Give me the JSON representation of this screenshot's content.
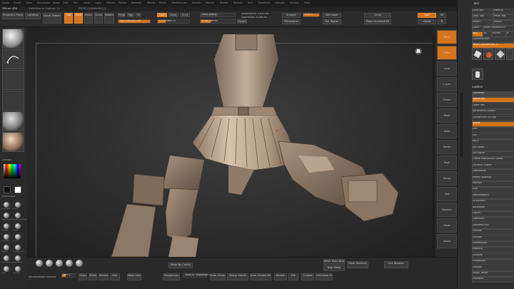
{
  "menu": [
    "Alpha",
    "Brush",
    "Color",
    "Document",
    "Draw",
    "Edit",
    "File",
    "Layer",
    "Light",
    "Macro",
    "Marker",
    "Material",
    "Movie",
    "Picker",
    "Preferences",
    "Render",
    "Stencil",
    "Stroke",
    "Texture",
    "Tool",
    "Transform",
    "Zplugin",
    "Zscript",
    "Help"
  ],
  "title": {
    "left": "ZBrush 4R6",
    "mid": "Switching to Subtool: 11",
    "name": "PM3D_Cylinder3D1_3"
  },
  "topbar": {
    "projection_master": "Projection Master",
    "lightbox": "LightBox",
    "quick_sketch": "Quick Sketch",
    "edit": "Edit",
    "draw": "Draw",
    "move": "Move",
    "scale": "Scale",
    "rotate": "Rotate",
    "mrgb": "Mrgb",
    "rgb": "Rgb",
    "m": "M",
    "zadd": "Zadd",
    "zsub": "Zsub",
    "zcut": "Zcut",
    "focal_shift": "Focal Shift 0",
    "draw_size": "Draw Size 64",
    "dynamic": "Dynamic",
    "rgb_intensity": "Rgb Intensity 100",
    "z_intensity": "Z Intensity 25",
    "active_points": "ActivePoints: 1.825 Mil",
    "total_points": "TotalPoints: 6.346 Mil",
    "smooth": "Smooth",
    "zremesher": "ZRemesher",
    "sdiv": "SDiv 5",
    "divide": "Divide",
    "del_lower": "Del Lower",
    "del_higher": "Del Higher",
    "clone": "Clone",
    "make_polymesh": "Make PolyMesh3D",
    "goz": "GoZ",
    "all": "All",
    "visible": "Visible",
    "r": "R"
  },
  "left_panel": {
    "labels": [
      "Standard",
      "Alpha Off",
      "Texture Off",
      "MatCap Gray",
      "Gradient",
      "SwitchColor",
      "Alternate",
      "Move",
      "Clay Buildup",
      "Move Topological",
      "hPolish",
      "Inflat",
      "Standard",
      "Pinch",
      "Slash2",
      "TrimDynamic",
      "Dam Standard",
      "ClayTubes",
      "Clay",
      "Smooth"
    ]
  },
  "bottom": {
    "backface": "BackfaceMask Previous",
    "mask_by_cavity": "Mask By Cavity",
    "blur": "Blur 2",
    "mask_labels": [
      "Grow",
      "Shrink",
      "Sharpen",
      "Blur"
    ],
    "mask_ambient": "Mask Ambient Occlusion",
    "mask_by_polygroups": "Mask By Polygroups 0",
    "polygroups": "Polygroups",
    "auto_groups": "Auto Groups",
    "group_visible": "Group Visible",
    "auto_groups_uv": "Auto Groups With UV",
    "double": "Double",
    "flip": "Flip",
    "crease": "Crease",
    "unc_all": "UnCrease All",
    "mesh_from_brush": "Mesh From Brush",
    "new_mesh": "New Mesh",
    "live_boolean": "Live Boolean",
    "mask_section": "Mask Sections"
  },
  "right_shelf": [
    "Persp",
    "Floor",
    "Local",
    "L.Sym",
    "Frame",
    "Move",
    "Scale",
    "Rotate",
    "PolyF",
    "Transp",
    "Solo",
    "Dynamic",
    "Ghost",
    "Xpose"
  ],
  "tool_panel": {
    "header": "Tool",
    "load_tool": "Load Tool",
    "save_as": "Save As",
    "copy_tool": "Copy Tool",
    "paste_tool": "Paste Tool",
    "import": "Import",
    "export": "Export",
    "clone": "Clone",
    "make_polymesh": "Make PolyMesh3D",
    "goz": "GoZ",
    "all": "All",
    "visible": "Visible",
    "r": "R",
    "lightbox_tools": "Lightbox▸Tools",
    "current_tool": "PM3D_Cylinder3D1_3",
    "thumb_labels": [
      "PM3D_Cylinder",
      "Cylinder3D",
      "PolyMesh3D",
      "SimpleBrush"
    ],
    "subtool_header": "Subtool",
    "items": [
      "Geometry",
      "Higher Res",
      "Lower Res",
      "Reconstruct Subdiv",
      "Convert BPR To Geo",
      "Divide",
      "Smt",
      "Suv",
      "ReUV",
      "Del Lower",
      "Del Higher",
      "Freeze SubDivision Levels",
      "Dynamic Subdiv",
      "ZRemesher",
      "Modify Topology",
      "Position",
      "Size",
      "MeshIntegrity",
      "ArrayMesh",
      "NanoMesh",
      "Layers",
      "FiberMesh",
      "Geometry HD",
      "Preview",
      "Surface",
      "Deformation",
      "Masking",
      "Visibility",
      "Polygroups",
      "Contact",
      "Morph Target",
      "Polypaint",
      "UV Map",
      "Texture Map",
      "Displacement Map",
      "Normal Map",
      "Vector Displacement Map",
      "Display Properties",
      "Unified Skin",
      "Initialize",
      "Import",
      "Export"
    ]
  },
  "colors": {
    "accent": "#d5741a",
    "bg": "#262626",
    "model": "#b49f8a"
  }
}
